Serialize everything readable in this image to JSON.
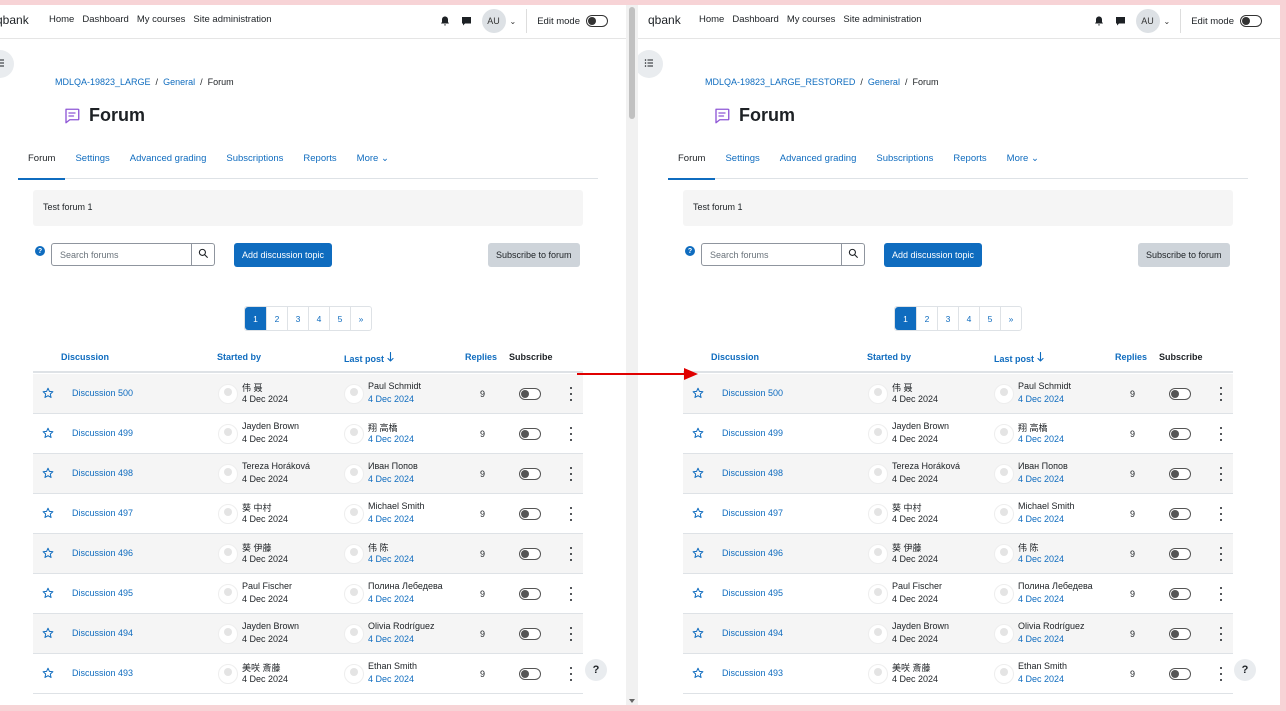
{
  "nav": {
    "brand_left": "qbank",
    "brand_right": "qbank",
    "links": [
      "Home",
      "Dashboard",
      "My courses",
      "Site administration"
    ],
    "user_initials": "AU",
    "edit_mode": "Edit mode"
  },
  "left": {
    "breadcrumb": [
      "MDLQA-19823_LARGE",
      "General",
      "Forum"
    ]
  },
  "right": {
    "breadcrumb": [
      "MDLQA-19823_LARGE_RESTORED",
      "General",
      "Forum"
    ]
  },
  "page": {
    "title": "Forum",
    "tabs": [
      "Forum",
      "Settings",
      "Advanced grading",
      "Subscriptions",
      "Reports",
      "More"
    ],
    "active_tab": "Forum",
    "description": "Test forum 1",
    "search_placeholder": "Search forums",
    "add_button": "Add discussion topic",
    "subscribe_button": "Subscribe to forum",
    "pages": [
      "1",
      "2",
      "3",
      "4",
      "5",
      "»"
    ],
    "current_page": "1",
    "columns": {
      "discussion": "Discussion",
      "started_by": "Started by",
      "last_post": "Last post",
      "replies": "Replies",
      "subscribe": "Subscribe"
    },
    "help": "?"
  },
  "discussions": [
    {
      "title": "Discussion 500",
      "started_by": "伟 聂",
      "started_date": "4 Dec 2024",
      "last_by": "Paul Schmidt",
      "last_date": "4 Dec 2024",
      "replies": "9"
    },
    {
      "title": "Discussion 499",
      "started_by": "Jayden Brown",
      "started_date": "4 Dec 2024",
      "last_by": "翔 高橋",
      "last_date": "4 Dec 2024",
      "replies": "9"
    },
    {
      "title": "Discussion 498",
      "started_by": "Tereza Horáková",
      "started_date": "4 Dec 2024",
      "last_by": "Иван Попов",
      "last_date": "4 Dec 2024",
      "replies": "9"
    },
    {
      "title": "Discussion 497",
      "started_by": "葵 中村",
      "started_date": "4 Dec 2024",
      "last_by": "Michael Smith",
      "last_date": "4 Dec 2024",
      "replies": "9"
    },
    {
      "title": "Discussion 496",
      "started_by": "葵 伊藤",
      "started_date": "4 Dec 2024",
      "last_by": "伟 陈",
      "last_date": "4 Dec 2024",
      "replies": "9"
    },
    {
      "title": "Discussion 495",
      "started_by": "Paul Fischer",
      "started_date": "4 Dec 2024",
      "last_by": "Полина Лебедева",
      "last_date": "4 Dec 2024",
      "replies": "9"
    },
    {
      "title": "Discussion 494",
      "started_by": "Jayden Brown",
      "started_date": "4 Dec 2024",
      "last_by": "Olivia Rodríguez",
      "last_date": "4 Dec 2024",
      "replies": "9"
    },
    {
      "title": "Discussion 493",
      "started_by": "美咲 斎藤",
      "started_date": "4 Dec 2024",
      "last_by": "Ethan Smith",
      "last_date": "4 Dec 2024",
      "replies": "9"
    }
  ],
  "colors": {
    "link": "#0f6cbf",
    "arrow": "#e00000",
    "frame": "#f7d3d6"
  }
}
